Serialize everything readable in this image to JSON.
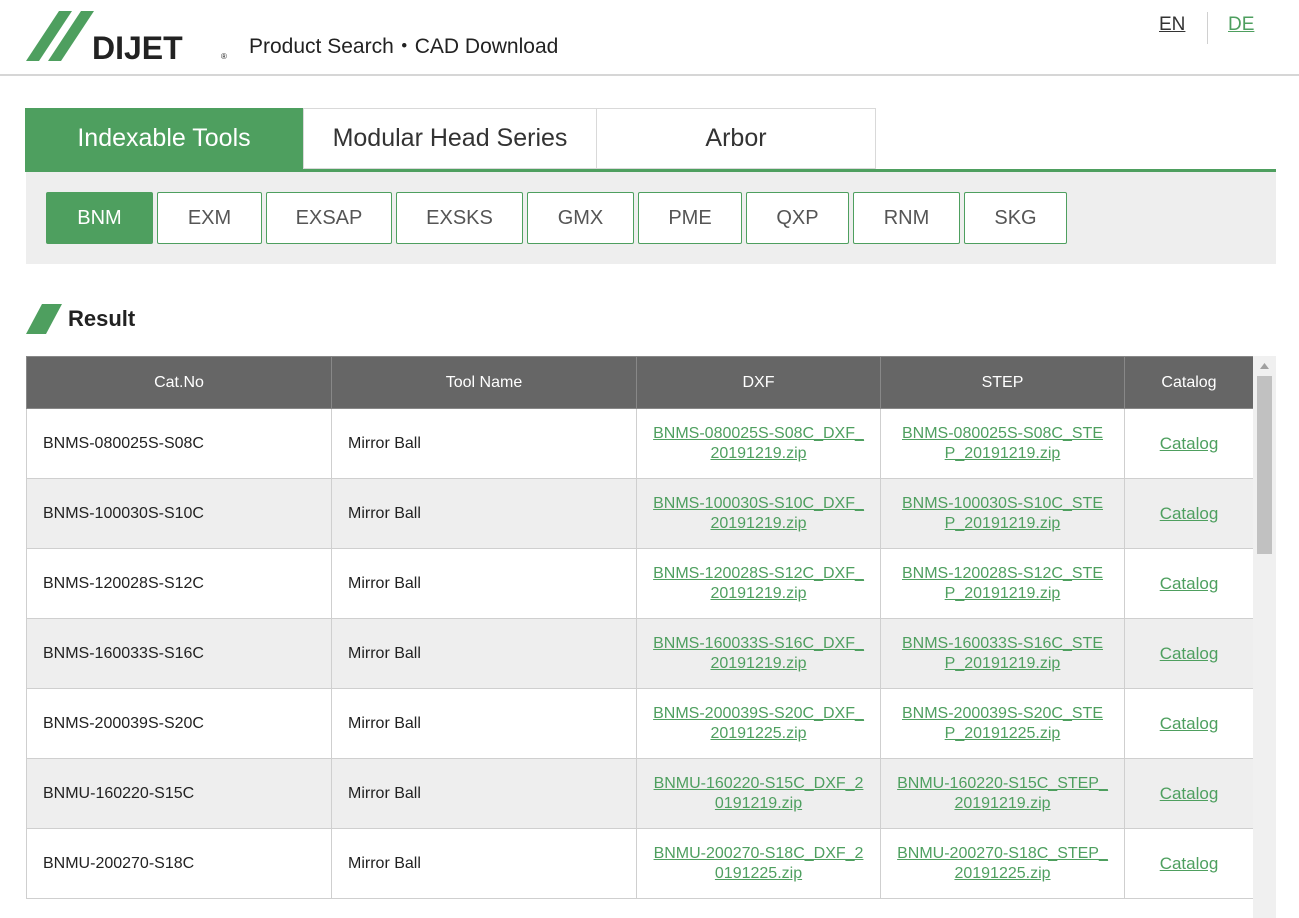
{
  "header": {
    "brand": "DIJET",
    "site_title": "Product Search・CAD Download",
    "lang_en": "EN",
    "lang_de": "DE"
  },
  "tabs": [
    {
      "label": "Indexable Tools",
      "active": true
    },
    {
      "label": "Modular Head Series",
      "active": false
    },
    {
      "label": "Arbor",
      "active": false
    }
  ],
  "series": [
    {
      "label": "BNM",
      "active": true
    },
    {
      "label": "EXM"
    },
    {
      "label": "EXSAP"
    },
    {
      "label": "EXSKS"
    },
    {
      "label": "GMX"
    },
    {
      "label": "PME"
    },
    {
      "label": "QXP"
    },
    {
      "label": "RNM"
    },
    {
      "label": "SKG"
    }
  ],
  "result": {
    "title": "Result",
    "columns": [
      "Cat.No",
      "Tool Name",
      "DXF",
      "STEP",
      "Catalog"
    ],
    "rows": [
      {
        "cat_no": "BNMS-080025S-S08C",
        "tool_name": "Mirror Ball",
        "dxf": "BNMS-080025S-S08C_DXF_20191219.zip",
        "step": "BNMS-080025S-S08C_STEP_20191219.zip",
        "catalog": "Catalog"
      },
      {
        "cat_no": "BNMS-100030S-S10C",
        "tool_name": "Mirror Ball",
        "dxf": "BNMS-100030S-S10C_DXF_20191219.zip",
        "step": "BNMS-100030S-S10C_STEP_20191219.zip",
        "catalog": "Catalog"
      },
      {
        "cat_no": "BNMS-120028S-S12C",
        "tool_name": "Mirror Ball",
        "dxf": "BNMS-120028S-S12C_DXF_20191219.zip",
        "step": "BNMS-120028S-S12C_STEP_20191219.zip",
        "catalog": "Catalog"
      },
      {
        "cat_no": "BNMS-160033S-S16C",
        "tool_name": "Mirror Ball",
        "dxf": "BNMS-160033S-S16C_DXF_20191219.zip",
        "step": "BNMS-160033S-S16C_STEP_20191219.zip",
        "catalog": "Catalog"
      },
      {
        "cat_no": "BNMS-200039S-S20C",
        "tool_name": "Mirror Ball",
        "dxf": "BNMS-200039S-S20C_DXF_20191225.zip",
        "step": "BNMS-200039S-S20C_STEP_20191225.zip",
        "catalog": "Catalog"
      },
      {
        "cat_no": "BNMU-160220-S15C",
        "tool_name": "Mirror Ball",
        "dxf": "BNMU-160220-S15C_DXF_20191219.zip",
        "step": "BNMU-160220-S15C_STEP_20191219.zip",
        "catalog": "Catalog"
      },
      {
        "cat_no": "BNMU-200270-S18C",
        "tool_name": "Mirror Ball",
        "dxf": "BNMU-200270-S18C_DXF_20191225.zip",
        "step": "BNMU-200270-S18C_STEP_20191225.zip",
        "catalog": "Catalog"
      }
    ]
  },
  "colors": {
    "accent": "#4e9f5f",
    "header_bg": "#666666",
    "alt_row": "#eeeeee"
  }
}
